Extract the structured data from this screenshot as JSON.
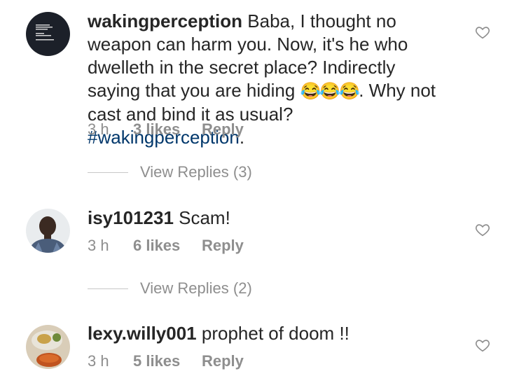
{
  "comments": [
    {
      "username": "wakingperception",
      "text_before": " Baba, I thought no weapon can harm you. Now, it's he who dwelleth in the secret place? Indirectly saying that you are hiding ",
      "emoji": "😂😂😂",
      "text_after": ". Why not cast and bind it as usual? ",
      "hashtag": "#wakingperception",
      "text_end": ".",
      "time": "3 h",
      "likes": "3 likes",
      "reply": "Reply",
      "view_replies": "View Replies (3)",
      "avatar_icon": "book-quote-avatar-icon"
    },
    {
      "username": "isy101231",
      "text": " Scam!",
      "time": "3 h",
      "likes": "6 likes",
      "reply": "Reply",
      "view_replies": "View Replies (2)",
      "avatar_icon": "person-photo-avatar-icon"
    },
    {
      "username": "lexy.willy001",
      "text": " prophet of doom !!",
      "time": "3 h",
      "likes": "5 likes",
      "reply": "Reply",
      "avatar_icon": "food-photo-avatar-icon"
    }
  ],
  "colors": {
    "text": "#262626",
    "meta": "#8e8e8e",
    "hashtag": "#00376b",
    "divider": "#c7c7c7"
  }
}
